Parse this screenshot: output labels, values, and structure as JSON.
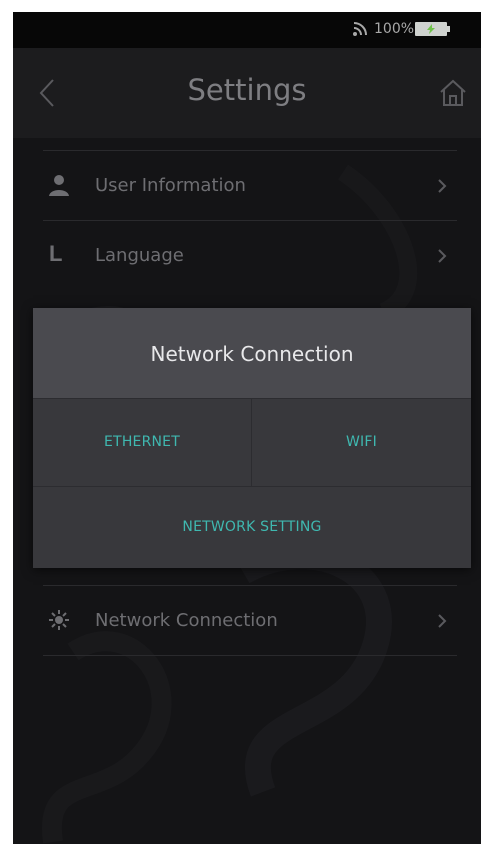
{
  "status_bar": {
    "battery_percent": "100%",
    "icons": [
      "signal-icon",
      "battery-charging-icon"
    ]
  },
  "header": {
    "title": "Settings",
    "icons": [
      "back-chevron-icon",
      "home-icon"
    ]
  },
  "menu": {
    "items": [
      {
        "label": "User Information",
        "icon": "user-icon"
      },
      {
        "label": "Language",
        "icon": "language-icon",
        "icon_text": "L"
      },
      {
        "label": "Network Connection",
        "icon": "network-icon"
      }
    ]
  },
  "dialog": {
    "title": "Network Connection",
    "options": {
      "ethernet": "ETHERNET",
      "wifi": "WIFI",
      "network_setting": "NETWORK SETTING"
    }
  },
  "colors": {
    "background": "#141416",
    "accent_teal": "#3fb8b0",
    "dialog_header": "#4a4a4f",
    "dialog_body": "#38383c",
    "text_dim": "#6e6e72"
  }
}
